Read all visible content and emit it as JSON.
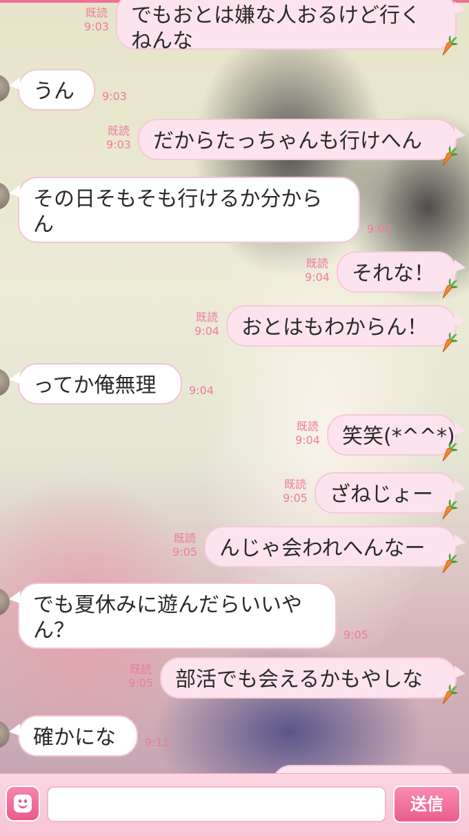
{
  "messages": [
    {
      "side": "out",
      "lines": [
        "でもおとは嫌な人おるけど行く",
        "ねんな"
      ],
      "read": "既読",
      "time": "9:03"
    },
    {
      "side": "in",
      "lines": [
        "うん"
      ],
      "time": "9:03"
    },
    {
      "side": "out",
      "lines": [
        "だからたっちゃんも行けへん"
      ],
      "read": "既読",
      "time": "9:03"
    },
    {
      "side": "in",
      "lines": [
        "その日そもそも行けるか分から",
        "ん"
      ],
      "time": "9:04"
    },
    {
      "side": "out",
      "lines": [
        "それな！"
      ],
      "read": "既読",
      "time": "9:04"
    },
    {
      "side": "out",
      "lines": [
        "おとはもわからん！"
      ],
      "read": "既読",
      "time": "9:04"
    },
    {
      "side": "in",
      "lines": [
        "ってか俺無理"
      ],
      "time": "9:04"
    },
    {
      "side": "out",
      "lines": [
        "笑笑(*^^*)"
      ],
      "read": "既読",
      "time": "9:04"
    },
    {
      "side": "out",
      "lines": [
        "ざねじょー"
      ],
      "read": "既読",
      "time": "9:05"
    },
    {
      "side": "out",
      "lines": [
        "んじゃ会われへんなー"
      ],
      "read": "既読",
      "time": "9:05"
    },
    {
      "side": "in",
      "lines": [
        "でも夏休みに遊んだらいいや",
        "ん？"
      ],
      "time": "9:05"
    },
    {
      "side": "out",
      "lines": [
        "部活でも会えるかもやしな"
      ],
      "read": "既読",
      "time": "9:05"
    },
    {
      "side": "in",
      "lines": [
        "確かにな"
      ],
      "time": "9:11"
    }
  ],
  "input": {
    "placeholder": "",
    "send_label": "送信",
    "emoji_icon": "smiley-face-icon"
  },
  "colors": {
    "accent": "#f06e98",
    "read_time_text": "#ef7aa0",
    "outgoing_bubble": "#fde3ee",
    "incoming_bubble": "#ffffff"
  },
  "icons": {
    "outgoing_sticker": "carrot-icon"
  }
}
